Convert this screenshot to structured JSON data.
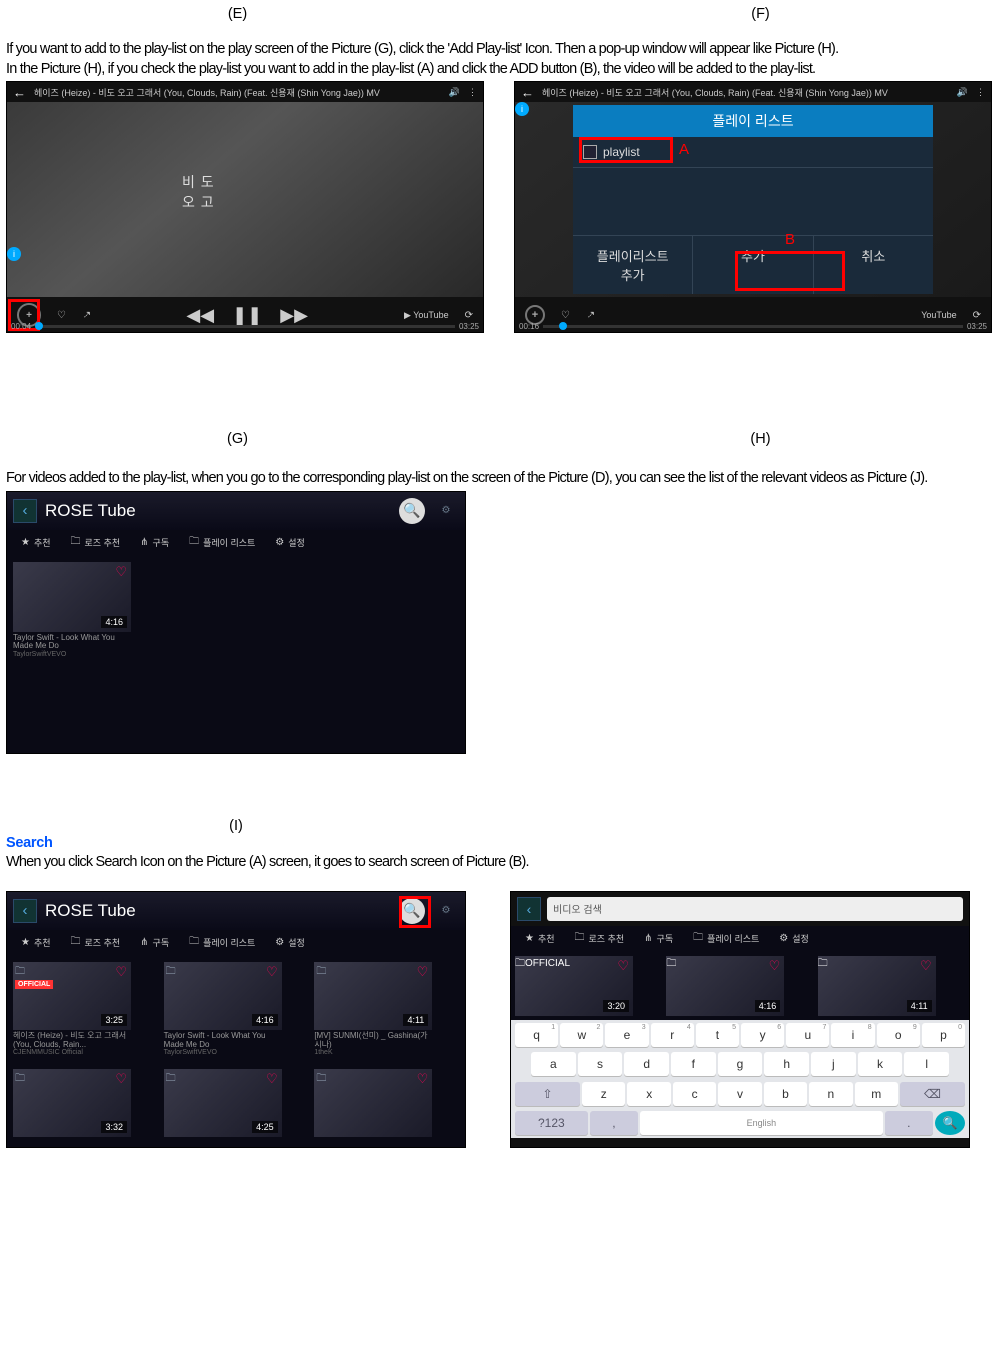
{
  "top_labels": {
    "e": "(E)",
    "f": "(F)"
  },
  "para1": "If you want to add to the play-list on the play screen of the Picture (G), click the 'Add Play-list' Icon. Then a pop-up window will appear like Picture (H).",
  "para2": "In the Picture (H), if you check the play-list you want to add in the play-list (A) and click the ADD button (B), the video will be added to the play-list.",
  "figG": {
    "title": "헤이즈 (Heize) - 비도 오고 그래서 (You, Clouds, Rain) (Feat. 신용재 (Shin Yong Jae)) MV",
    "overlay_line1": "비    도",
    "overlay_line2": "오    고",
    "time_left": "00:04",
    "time_right": "03:25",
    "youtube": "YouTube"
  },
  "figH": {
    "title": "헤이즈 (Heize) - 비도 오고 그래서 (You, Clouds, Rain) (Feat. 신용재 (Shin Yong Jae)) MV",
    "popup_title": "플레이 리스트",
    "item": "playlist",
    "labelA": "A",
    "labelB": "B",
    "btn1": "플레이리스트\n추가",
    "btn2": "추가",
    "btn3": "취소",
    "youtube": "YouTube",
    "time_left": "00:16",
    "time_right": "03:25"
  },
  "label_g": "(G)",
  "label_h": "(H)",
  "para3": "For videos added to the play-list, when you go to the corresponding play-list on the screen of the Picture (D), you can see the list of the relevant videos as Picture (J).",
  "figI": {
    "app": "ROSE Tube",
    "tabs": [
      "추천",
      "로즈 추천",
      "구독",
      "플레이 리스트",
      "설정"
    ],
    "thumb": {
      "dur": "4:16",
      "title": "Taylor Swift - Look What You Made Me Do",
      "sub": "TaylorSwiftVEVO"
    }
  },
  "label_i": "(I)",
  "search_heading": "Search",
  "para4": "When you click Search Icon on the Picture (A) screen, it goes to search screen of Picture (B).",
  "figA": {
    "app": "ROSE Tube",
    "tabs": [
      "추천",
      "로즈 추천",
      "구독",
      "플레이 리스트",
      "설정"
    ],
    "thumbs": [
      {
        "dur": "3:25",
        "title": "헤이즈 (Heize) - 비도 오고 그래서 (You, Clouds, Rain...",
        "sub": "CJENMMUSIC Official",
        "official": "OFFICIAL"
      },
      {
        "dur": "4:16",
        "title": "Taylor Swift - Look What You Made Me Do",
        "sub": "TaylorSwiftVEVO"
      },
      {
        "dur": "4:11",
        "title": "[MV] SUNMI(선미) _ Gashina(가시나)",
        "sub": "1theK"
      },
      {
        "dur": "3:32",
        "title": "",
        "sub": ""
      },
      {
        "dur": "4:25",
        "title": "",
        "sub": ""
      },
      {
        "dur": "",
        "title": "",
        "sub": ""
      }
    ]
  },
  "figB": {
    "placeholder": "비디오 검색",
    "tabs": [
      "추천",
      "로즈 추천",
      "구독",
      "플레이 리스트",
      "설정"
    ],
    "thumbs": [
      {
        "dur": "3:20",
        "official": "OFFICIAL"
      },
      {
        "dur": "4:16"
      },
      {
        "dur": "4:11"
      }
    ],
    "kb": {
      "row1": [
        "q",
        "w",
        "e",
        "r",
        "t",
        "y",
        "u",
        "i",
        "o",
        "p"
      ],
      "row1_sup": [
        "1",
        "2",
        "3",
        "4",
        "5",
        "6",
        "7",
        "8",
        "9",
        "0"
      ],
      "row2": [
        "a",
        "s",
        "d",
        "f",
        "g",
        "h",
        "j",
        "k",
        "l"
      ],
      "row3_shift": "⇧",
      "row3": [
        "z",
        "x",
        "c",
        "v",
        "b",
        "n",
        "m"
      ],
      "row3_back": "⌫",
      "row4_num": "?123",
      "row4_comma": ",",
      "row4_space": "English",
      "row4_dot": "."
    }
  }
}
